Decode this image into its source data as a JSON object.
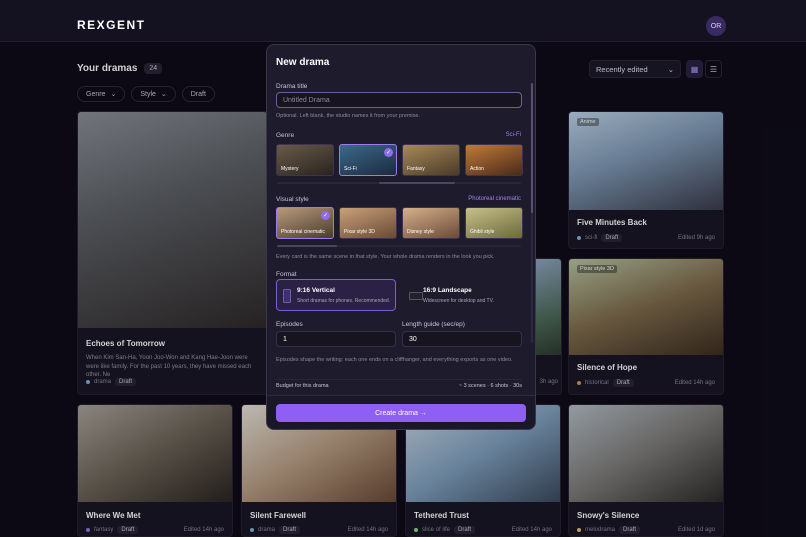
{
  "header": {
    "logo": "REXGENT",
    "avatar": "OR"
  },
  "page": {
    "title": "Your dramas",
    "count": "24",
    "filters": [
      "Genre",
      "Style",
      "Draft"
    ],
    "sort": "Recently edited"
  },
  "cards": [
    {
      "title": "Echoes of Tomorrow",
      "desc": "When Kim San-Ha, Yoon Joo-Won and Kang Hae-Joon were were like family. For the past 10 years, they have missed each other. Ne",
      "genre": "drama",
      "status": "Draft",
      "edited": ""
    },
    {
      "badge": "Anime",
      "title": "Five Minutes Back",
      "genre": "sci-fi",
      "status": "Draft",
      "edited": "Edited 9h ago"
    },
    {
      "badge": "Pixar style 3D",
      "title": "Silence of Hope",
      "genre": "historical",
      "status": "Draft",
      "edited": "Edited 14h ago"
    },
    {
      "title": "",
      "genre": "",
      "status": "",
      "edited": "3h ago"
    },
    {
      "title": "Where We Met",
      "genre": "fantasy",
      "status": "Draft",
      "edited": "Edited 14h ago"
    },
    {
      "title": "Silent Farewell",
      "genre": "drama",
      "status": "Draft",
      "edited": "Edited 14h ago"
    },
    {
      "title": "Tethered Trust",
      "genre": "slice of life",
      "status": "Draft",
      "edited": "Edited 14h ago"
    },
    {
      "title": "Snowy's Silence",
      "genre": "melodrama",
      "status": "Draft",
      "edited": "Edited 1d ago"
    }
  ],
  "modal": {
    "title": "New drama",
    "title_label": "Drama title",
    "title_placeholder": "Untitled Drama",
    "title_hint": "Optional. Left blank, the studio names it from your premise.",
    "genre_label": "Genre",
    "genre_selected": "Sci-Fi",
    "genres": [
      "Mystery",
      "Sci-Fi",
      "Fantasy",
      "Action"
    ],
    "style_label": "Visual style",
    "style_selected": "Photoreal cinematic",
    "styles": [
      "Photoreal cinematic",
      "Pixar style 3D",
      "Disney style",
      "Ghibli style"
    ],
    "style_hint": "Every card is the same scene in that style. Your whole drama renders in the look you pick.",
    "format_label": "Format",
    "formats": [
      {
        "title": "9:16 Vertical",
        "desc": "Short dramas for phones. Recommended."
      },
      {
        "title": "16:9 Landscape",
        "desc": "Widescreen for desktop and TV."
      }
    ],
    "episodes_label": "Episodes",
    "episodes_value": "1",
    "length_label": "Length guide (sec/ep)",
    "length_value": "30",
    "episodes_hint": "Episodes shape the writing: each one ends on a cliffhanger, and everything exports as one video.",
    "budget_label": "Budget for this drama",
    "budget_value": "~ 3 scenes · 6 shots · 30s",
    "cta": "Create drama →"
  }
}
